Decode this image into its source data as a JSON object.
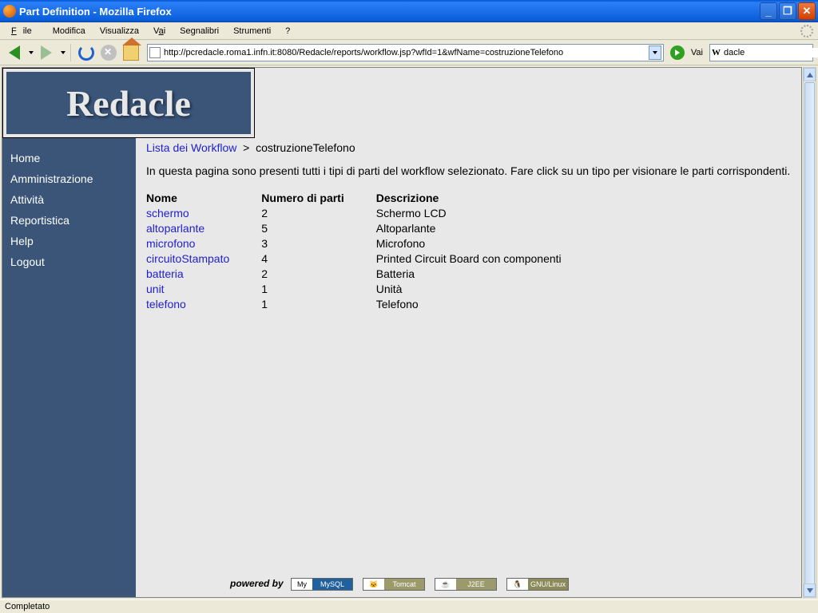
{
  "window": {
    "title": "Part Definition - Mozilla Firefox"
  },
  "menu": {
    "file": "File",
    "modifica": "Modifica",
    "visualizza": "Visualizza",
    "vai": "Vai",
    "segnalibri": "Segnalibri",
    "strumenti": "Strumenti",
    "help": "?"
  },
  "toolbar": {
    "url": "http://pcredacle.roma1.infn.it:8080/Redacle/reports/workflow.jsp?wfId=1&wfName=costruzioneTelefono",
    "go_label": "Vai",
    "search_value": "dacle"
  },
  "logo": {
    "text": "Redacle"
  },
  "sidebar": {
    "items": [
      {
        "label": "Home"
      },
      {
        "label": "Amministrazione"
      },
      {
        "label": "Attività"
      },
      {
        "label": "Reportistica"
      },
      {
        "label": "Help"
      },
      {
        "label": "Logout"
      }
    ]
  },
  "breadcrumb": {
    "root": "Lista dei Workflow",
    "sep": ">",
    "current": "costruzioneTelefono"
  },
  "intro": "In questa pagina sono presenti tutti i tipi di parti del workflow selezionato. Fare click su un tipo per visionare le parti corrispondenti.",
  "table": {
    "headers": {
      "name": "Nome",
      "count": "Numero di parti",
      "desc": "Descrizione"
    },
    "rows": [
      {
        "name": "schermo",
        "count": "2",
        "desc": "Schermo LCD"
      },
      {
        "name": "altoparlante",
        "count": "5",
        "desc": "Altoparlante"
      },
      {
        "name": "microfono",
        "count": "3",
        "desc": "Microfono"
      },
      {
        "name": "circuitoStampato",
        "count": "4",
        "desc": "Printed Circuit Board con componenti"
      },
      {
        "name": "batteria",
        "count": "2",
        "desc": "Batteria"
      },
      {
        "name": "unit",
        "count": "1",
        "desc": "Unità"
      },
      {
        "name": "telefono",
        "count": "1",
        "desc": "Telefono"
      }
    ]
  },
  "footer": {
    "powered": "powered by",
    "badges": [
      {
        "left": "My",
        "right": "MySQL",
        "cls": "br-mysql"
      },
      {
        "left": "🐱",
        "right": "Tomcat",
        "cls": "br-tomcat"
      },
      {
        "left": "☕",
        "right": "J2EE",
        "cls": "br-j2ee"
      },
      {
        "left": "🐧",
        "right": "GNU/Linux",
        "cls": "br-linux"
      }
    ]
  },
  "status": {
    "text": "Completato"
  }
}
